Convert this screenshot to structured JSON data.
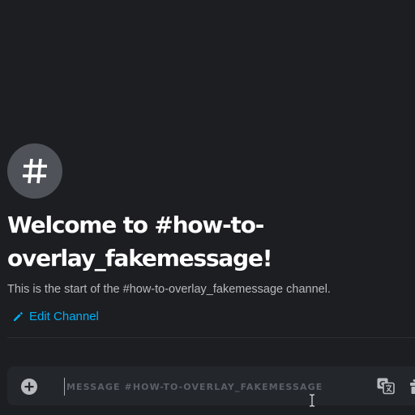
{
  "channel": {
    "icon": "hashtag-icon",
    "welcome_title": "Welcome to #how-to-overlay_fakemessage!",
    "welcome_subtitle": "This is the start of the #how-to-overlay_fakemessage channel.",
    "edit_label": "Edit Channel"
  },
  "composer": {
    "placeholder": "MESSAGE #HOW-TO-OVERLAY_FAKEMESSAGE",
    "value": ""
  },
  "icons": {
    "attach": "plus-circle-icon",
    "translate": "translate-icon",
    "gift": "gift-icon",
    "edit": "pencil-icon",
    "pointer": "text-cursor-icon"
  },
  "colors": {
    "background": "#1c1e22",
    "composer_background": "#23262b",
    "hash_badge": "#4f5359",
    "link": "#00aff4",
    "title": "#ffffff",
    "subtitle": "#b9bbbe"
  }
}
